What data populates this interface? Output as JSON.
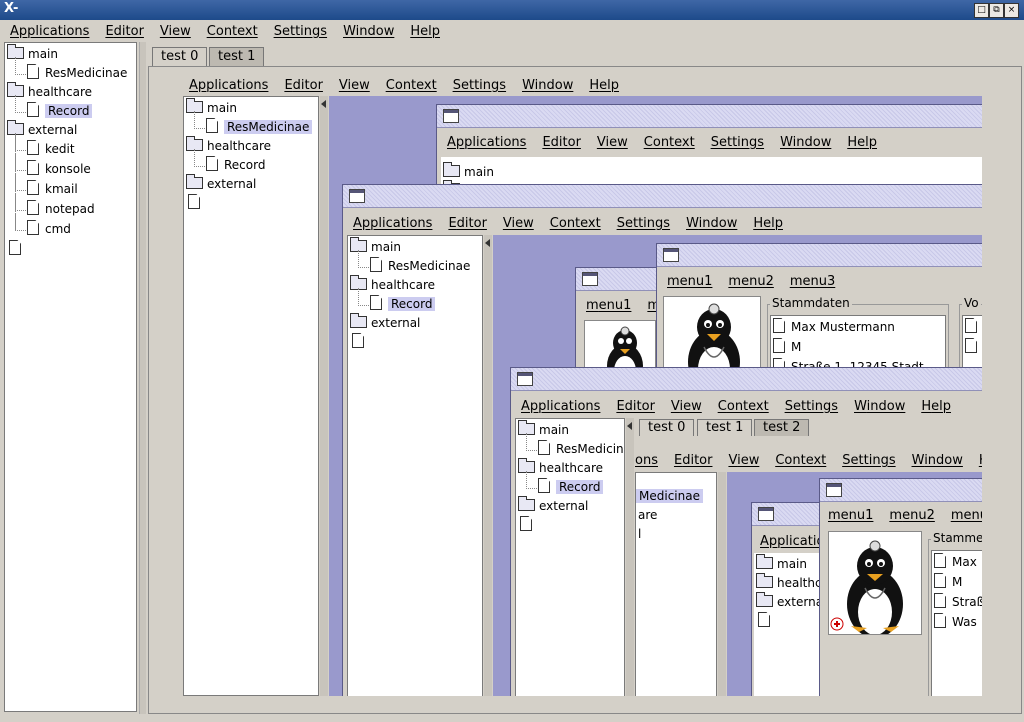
{
  "window": {
    "title_icon": "X-",
    "buttons": [
      "□",
      "⧉",
      "×"
    ]
  },
  "menu": [
    "Applications",
    "Editor",
    "View",
    "Context",
    "Settings",
    "Window",
    "Help"
  ],
  "tree": {
    "main": "main",
    "resmed": "ResMedicinae",
    "healthcare": "healthcare",
    "record": "Record",
    "external": "external",
    "kedit": "kedit",
    "konsole": "konsole",
    "kmail": "kmail",
    "notepad": "notepad",
    "cmd": "cmd"
  },
  "tabs": {
    "t0": "test 0",
    "t1": "test 1",
    "t2": "test 2"
  },
  "record_menu": [
    "menu1",
    "menu2",
    "menu3"
  ],
  "record_menu_trunc": "me",
  "stammdaten": "Stammdaten",
  "stammdaten_trunc": "Stamme",
  "vo": "Vo",
  "fields": {
    "name": "Max Mustermann",
    "sex": "M",
    "street": "Straße 1, 12345 Stadt",
    "name_short": "Max",
    "street_short": "Straß",
    "was": "Was"
  },
  "trunc": {
    "ons": "ons",
    "medicinae": "Medicinae",
    "are": "are",
    "l": "l",
    "applicatio": "Applicatio",
    "healthc": "healthc",
    "externa": "externa",
    "resmedicina": "ResMedicina"
  }
}
